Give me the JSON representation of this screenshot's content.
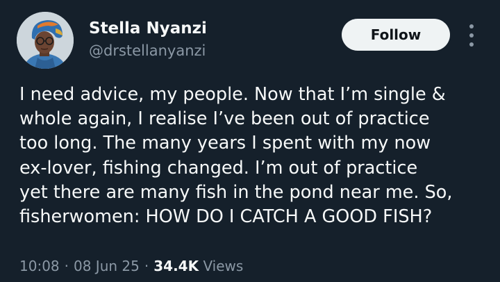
{
  "author": {
    "display_name": "Stella Nyanzi",
    "handle": "@drstellanyanzi"
  },
  "actions": {
    "follow_label": "Follow",
    "more_icon": "more-vertical-icon"
  },
  "tweet": {
    "lines": [
      "I need advice, my people. Now that I’m single &",
      "whole again, I realise I’ve been out of practice",
      "too long. The many years I spent with my now",
      "ex-lover, fishing changed. I’m out of practice",
      "yet there are many fish in the pond near me. So,",
      "fisherwomen: HOW DO I CATCH A GOOD FISH?"
    ]
  },
  "meta": {
    "time": "10:08",
    "separator": "·",
    "date": "08 Jun 25",
    "views_count": "34.4K",
    "views_label": "Views"
  },
  "colors": {
    "background": "#15202b",
    "primary_text": "#f7f9f9",
    "secondary_text": "#8b98a5",
    "follow_button_bg": "#eff3f4",
    "follow_button_text": "#0f1419"
  }
}
